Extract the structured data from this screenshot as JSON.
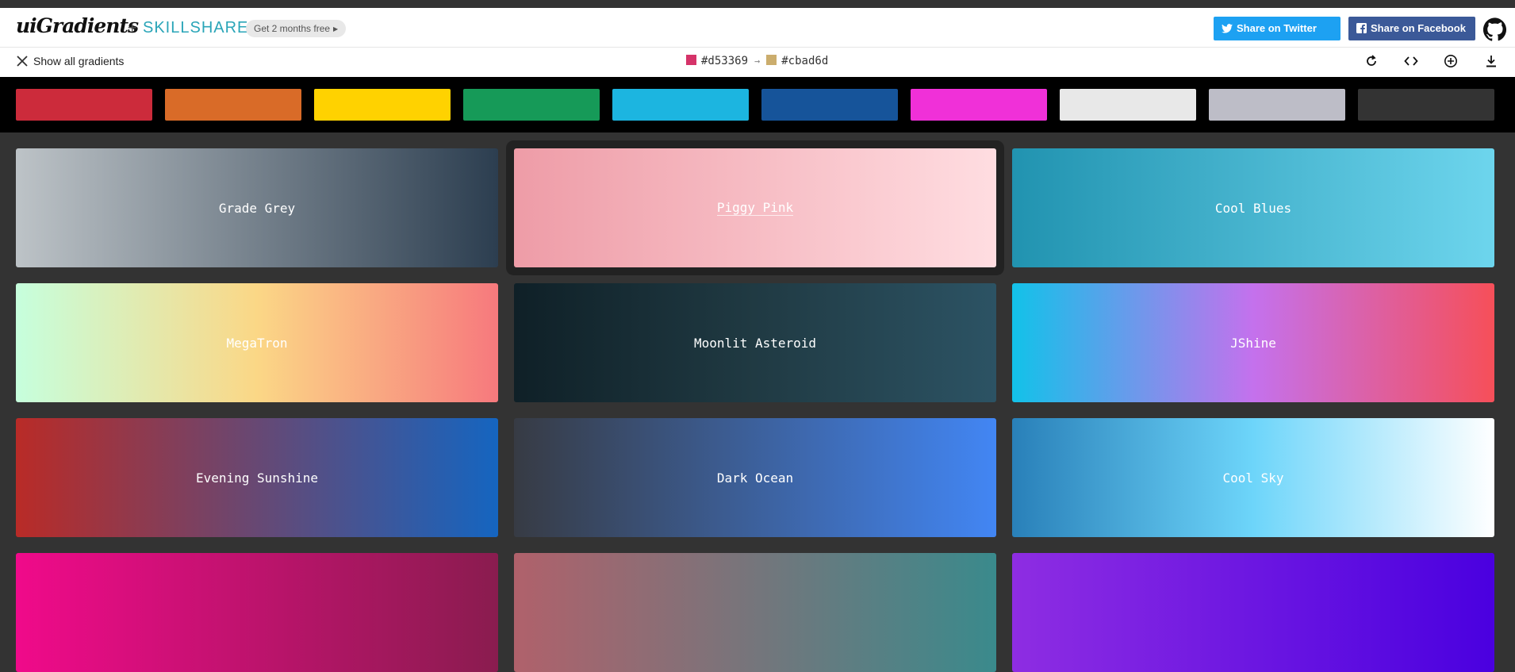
{
  "header": {
    "brand": "uiGradients",
    "plus": "+",
    "partner": "SKILLSHARE",
    "promo": "Get 2 months free",
    "share_twitter": "Share on Twitter",
    "share_facebook": "Share on Facebook"
  },
  "toolbar": {
    "show_all": "Show all gradients",
    "color_from": "#d53369",
    "color_to": "#cbad6d",
    "arrow": "→"
  },
  "palette_filters": [
    {
      "name": "red",
      "color": "#cc2b3b"
    },
    {
      "name": "orange",
      "color": "#d96b28"
    },
    {
      "name": "yellow",
      "color": "#ffd200"
    },
    {
      "name": "green",
      "color": "#169a58"
    },
    {
      "name": "cyan",
      "color": "#1cb5e0"
    },
    {
      "name": "blue",
      "color": "#16549a"
    },
    {
      "name": "magenta",
      "color": "#f030d8"
    },
    {
      "name": "white",
      "color": "#e8e8e8"
    },
    {
      "name": "grey",
      "color": "#bdbdc7"
    },
    {
      "name": "black",
      "color": "#333333"
    }
  ],
  "gradients": [
    {
      "name": "Grade Grey",
      "from": "#bdc3c7",
      "to": "#2c3e50"
    },
    {
      "name": "Piggy Pink",
      "from": "#ee9ca7",
      "to": "#ffdde1"
    },
    {
      "name": "Cool Blues",
      "from": "#2193b0",
      "to": "#6dd5ed"
    },
    {
      "name": "MegaTron",
      "stops": [
        "#c6ffdd",
        "#fbd786",
        "#f7797d"
      ]
    },
    {
      "name": "Moonlit Asteroid",
      "stops": [
        "#0f2027",
        "#203a43",
        "#2c5364"
      ]
    },
    {
      "name": "JShine",
      "stops": [
        "#12c2e9",
        "#c471ed",
        "#f64f59"
      ]
    },
    {
      "name": "Evening Sunshine",
      "from": "#b92b27",
      "to": "#1565c0"
    },
    {
      "name": "Dark Ocean",
      "from": "#373b44",
      "to": "#4286f4"
    },
    {
      "name": "Cool Sky",
      "stops": [
        "#2980b9",
        "#6dd5fa",
        "#ffffff"
      ]
    },
    {
      "name": "",
      "from": "#f00a8a",
      "to": "#8a1c4f"
    },
    {
      "name": "",
      "from": "#b0616b",
      "to": "#3a8a8c"
    },
    {
      "name": "",
      "from": "#8e2de2",
      "to": "#4a00e0"
    }
  ],
  "selected_index": 1
}
